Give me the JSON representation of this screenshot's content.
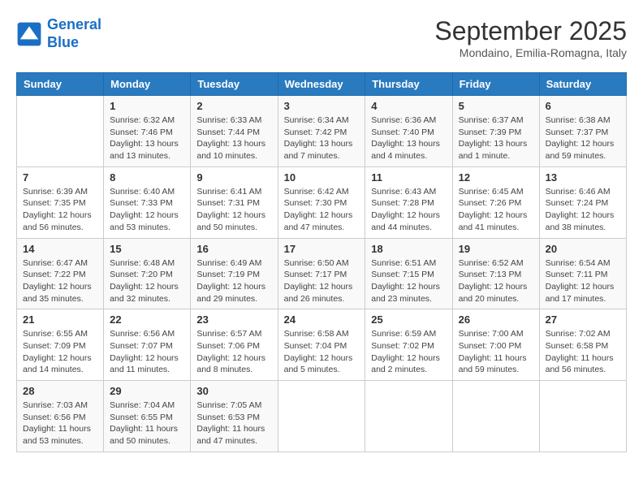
{
  "header": {
    "logo_line1": "General",
    "logo_line2": "Blue",
    "month": "September 2025",
    "location": "Mondaino, Emilia-Romagna, Italy"
  },
  "days_of_week": [
    "Sunday",
    "Monday",
    "Tuesday",
    "Wednesday",
    "Thursday",
    "Friday",
    "Saturday"
  ],
  "weeks": [
    [
      {
        "day": "",
        "content": ""
      },
      {
        "day": "1",
        "content": "Sunrise: 6:32 AM\nSunset: 7:46 PM\nDaylight: 13 hours and 13 minutes."
      },
      {
        "day": "2",
        "content": "Sunrise: 6:33 AM\nSunset: 7:44 PM\nDaylight: 13 hours and 10 minutes."
      },
      {
        "day": "3",
        "content": "Sunrise: 6:34 AM\nSunset: 7:42 PM\nDaylight: 13 hours and 7 minutes."
      },
      {
        "day": "4",
        "content": "Sunrise: 6:36 AM\nSunset: 7:40 PM\nDaylight: 13 hours and 4 minutes."
      },
      {
        "day": "5",
        "content": "Sunrise: 6:37 AM\nSunset: 7:39 PM\nDaylight: 13 hours and 1 minute."
      },
      {
        "day": "6",
        "content": "Sunrise: 6:38 AM\nSunset: 7:37 PM\nDaylight: 12 hours and 59 minutes."
      }
    ],
    [
      {
        "day": "7",
        "content": "Sunrise: 6:39 AM\nSunset: 7:35 PM\nDaylight: 12 hours and 56 minutes."
      },
      {
        "day": "8",
        "content": "Sunrise: 6:40 AM\nSunset: 7:33 PM\nDaylight: 12 hours and 53 minutes."
      },
      {
        "day": "9",
        "content": "Sunrise: 6:41 AM\nSunset: 7:31 PM\nDaylight: 12 hours and 50 minutes."
      },
      {
        "day": "10",
        "content": "Sunrise: 6:42 AM\nSunset: 7:30 PM\nDaylight: 12 hours and 47 minutes."
      },
      {
        "day": "11",
        "content": "Sunrise: 6:43 AM\nSunset: 7:28 PM\nDaylight: 12 hours and 44 minutes."
      },
      {
        "day": "12",
        "content": "Sunrise: 6:45 AM\nSunset: 7:26 PM\nDaylight: 12 hours and 41 minutes."
      },
      {
        "day": "13",
        "content": "Sunrise: 6:46 AM\nSunset: 7:24 PM\nDaylight: 12 hours and 38 minutes."
      }
    ],
    [
      {
        "day": "14",
        "content": "Sunrise: 6:47 AM\nSunset: 7:22 PM\nDaylight: 12 hours and 35 minutes."
      },
      {
        "day": "15",
        "content": "Sunrise: 6:48 AM\nSunset: 7:20 PM\nDaylight: 12 hours and 32 minutes."
      },
      {
        "day": "16",
        "content": "Sunrise: 6:49 AM\nSunset: 7:19 PM\nDaylight: 12 hours and 29 minutes."
      },
      {
        "day": "17",
        "content": "Sunrise: 6:50 AM\nSunset: 7:17 PM\nDaylight: 12 hours and 26 minutes."
      },
      {
        "day": "18",
        "content": "Sunrise: 6:51 AM\nSunset: 7:15 PM\nDaylight: 12 hours and 23 minutes."
      },
      {
        "day": "19",
        "content": "Sunrise: 6:52 AM\nSunset: 7:13 PM\nDaylight: 12 hours and 20 minutes."
      },
      {
        "day": "20",
        "content": "Sunrise: 6:54 AM\nSunset: 7:11 PM\nDaylight: 12 hours and 17 minutes."
      }
    ],
    [
      {
        "day": "21",
        "content": "Sunrise: 6:55 AM\nSunset: 7:09 PM\nDaylight: 12 hours and 14 minutes."
      },
      {
        "day": "22",
        "content": "Sunrise: 6:56 AM\nSunset: 7:07 PM\nDaylight: 12 hours and 11 minutes."
      },
      {
        "day": "23",
        "content": "Sunrise: 6:57 AM\nSunset: 7:06 PM\nDaylight: 12 hours and 8 minutes."
      },
      {
        "day": "24",
        "content": "Sunrise: 6:58 AM\nSunset: 7:04 PM\nDaylight: 12 hours and 5 minutes."
      },
      {
        "day": "25",
        "content": "Sunrise: 6:59 AM\nSunset: 7:02 PM\nDaylight: 12 hours and 2 minutes."
      },
      {
        "day": "26",
        "content": "Sunrise: 7:00 AM\nSunset: 7:00 PM\nDaylight: 11 hours and 59 minutes."
      },
      {
        "day": "27",
        "content": "Sunrise: 7:02 AM\nSunset: 6:58 PM\nDaylight: 11 hours and 56 minutes."
      }
    ],
    [
      {
        "day": "28",
        "content": "Sunrise: 7:03 AM\nSunset: 6:56 PM\nDaylight: 11 hours and 53 minutes."
      },
      {
        "day": "29",
        "content": "Sunrise: 7:04 AM\nSunset: 6:55 PM\nDaylight: 11 hours and 50 minutes."
      },
      {
        "day": "30",
        "content": "Sunrise: 7:05 AM\nSunset: 6:53 PM\nDaylight: 11 hours and 47 minutes."
      },
      {
        "day": "",
        "content": ""
      },
      {
        "day": "",
        "content": ""
      },
      {
        "day": "",
        "content": ""
      },
      {
        "day": "",
        "content": ""
      }
    ]
  ]
}
